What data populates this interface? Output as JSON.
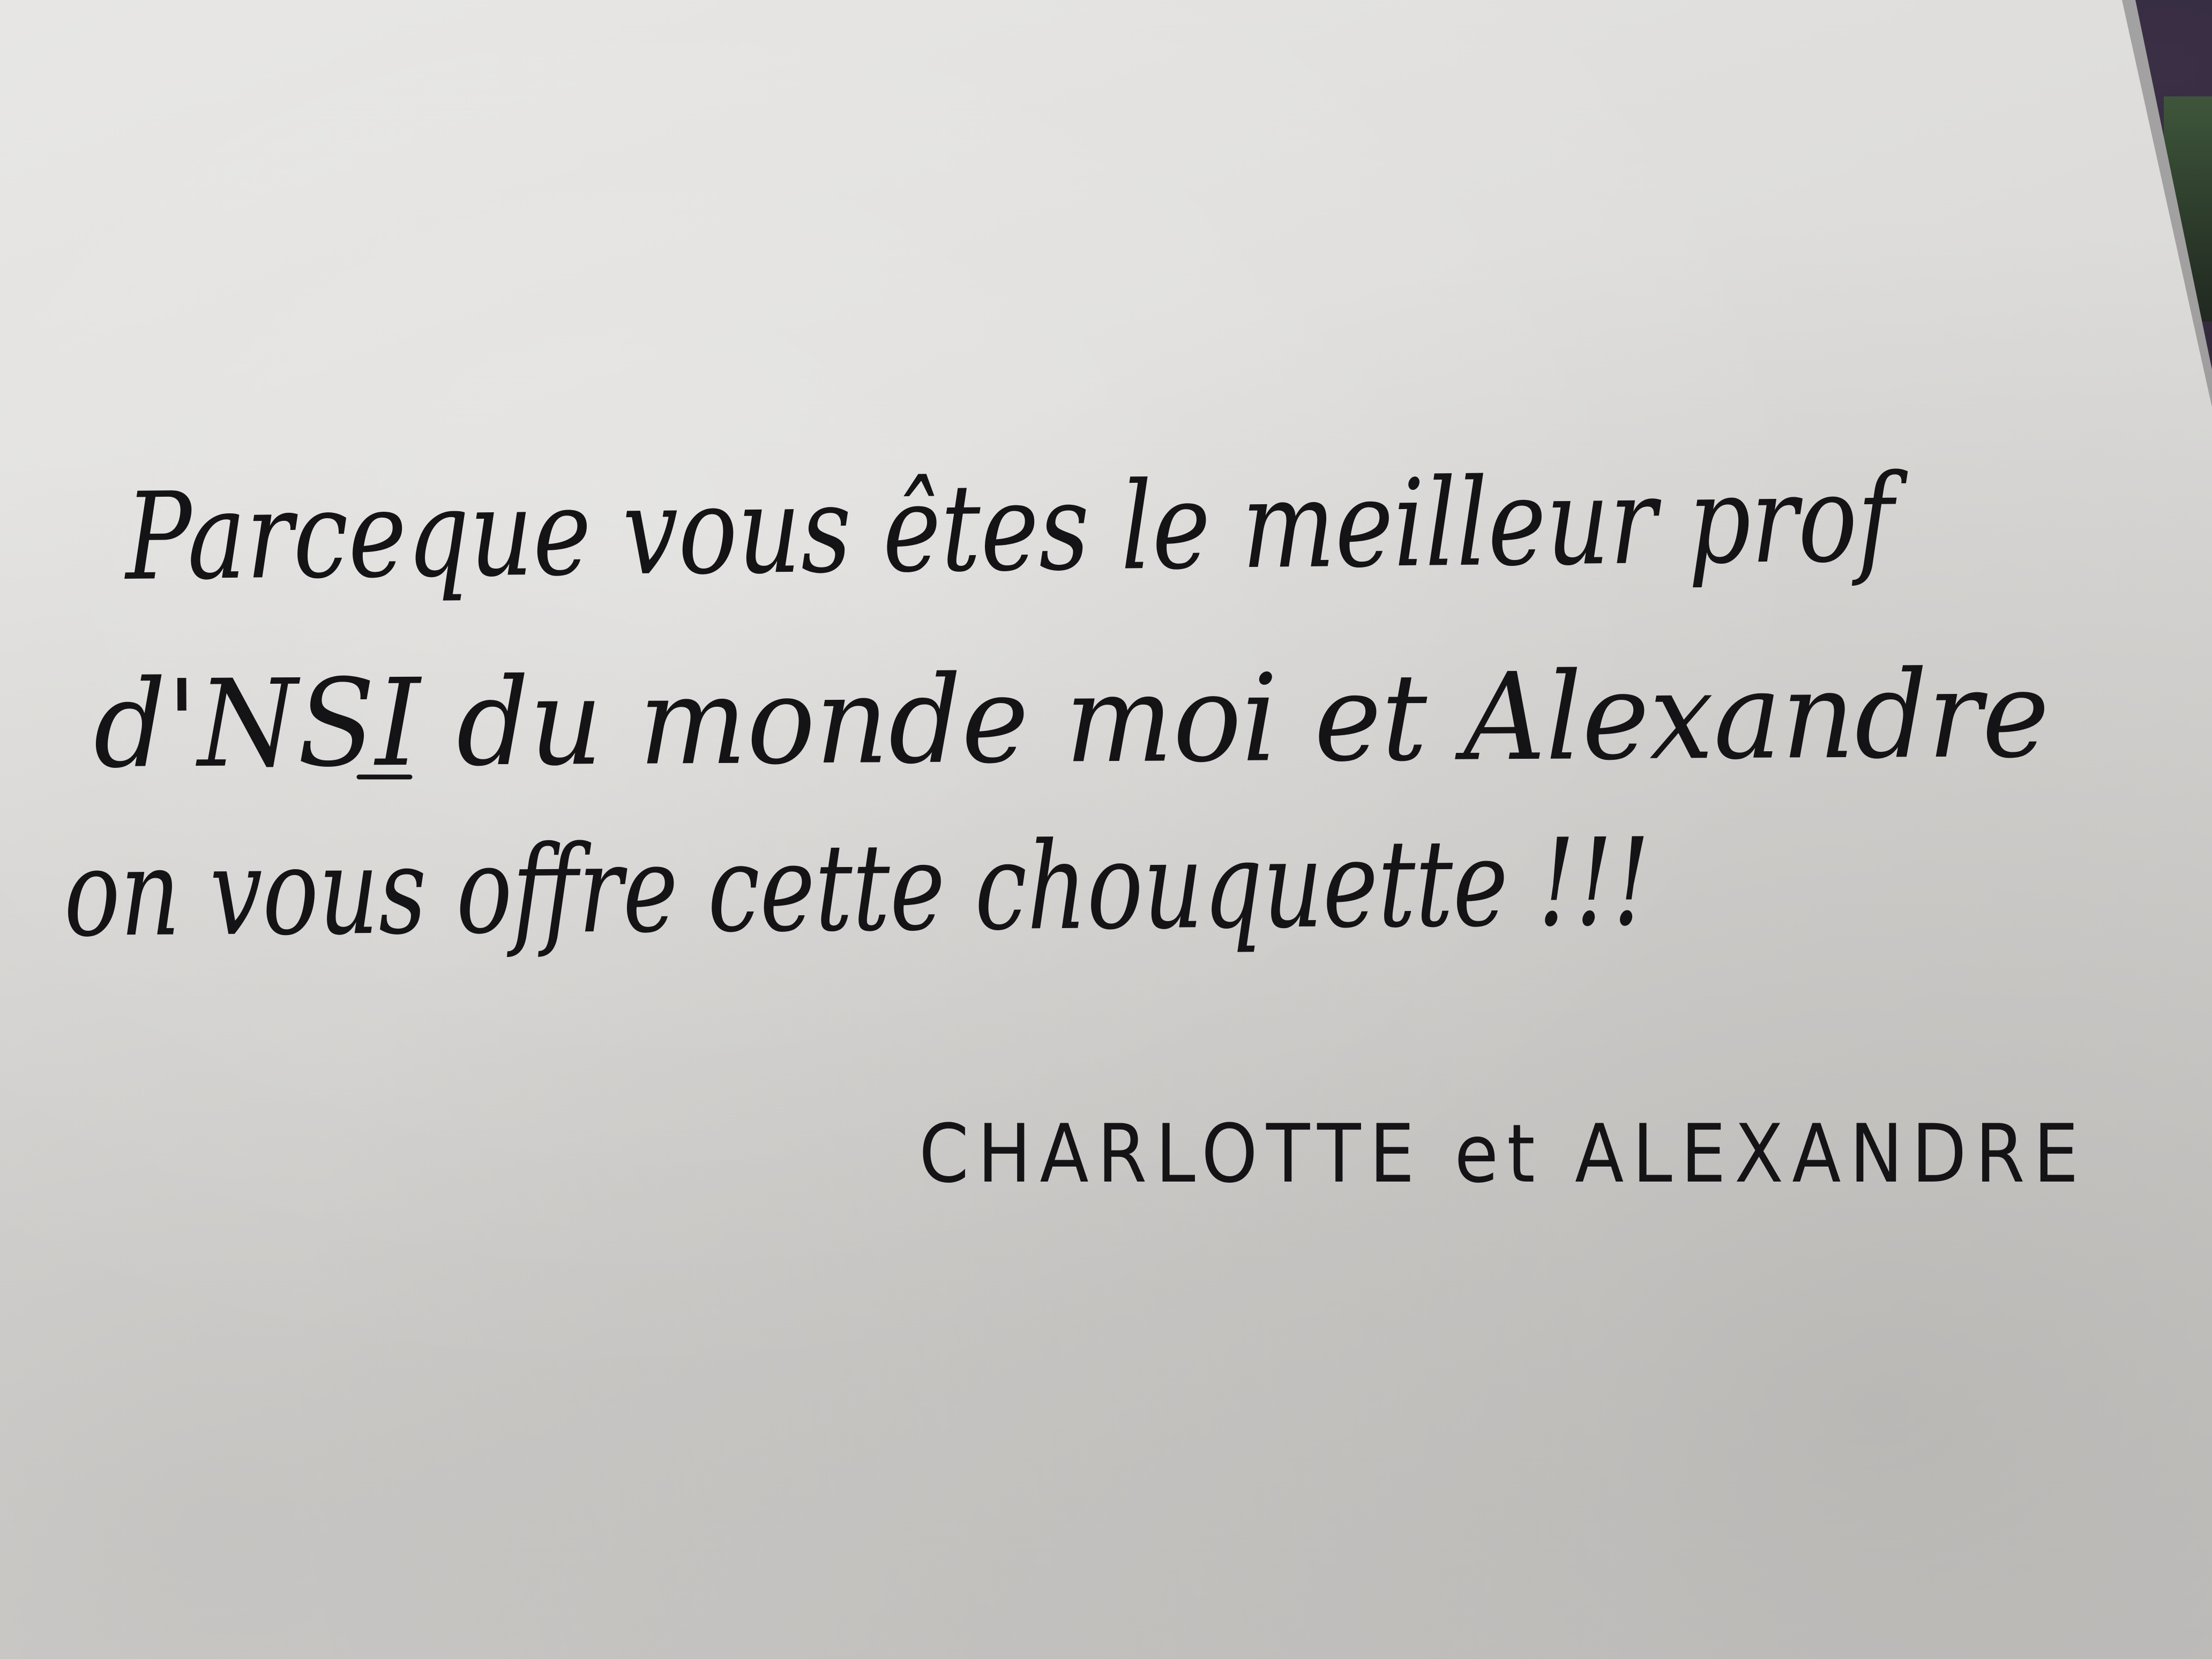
{
  "note": {
    "lines": [
      "Parceque vous êtes le meilleur prof",
      "d'NSI du monde moi et Alexandre",
      "on vous offre cette chouquette !!!"
    ],
    "signature": "CHARLOTTE et ALEXANDRE"
  },
  "colors": {
    "paper": "#dddcda",
    "ink": "#141416",
    "background": "#24202a"
  }
}
